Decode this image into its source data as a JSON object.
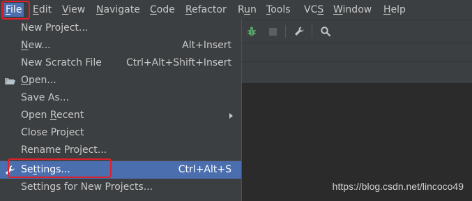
{
  "menubar": {
    "items": [
      "File",
      "Edit",
      "View",
      "Navigate",
      "Code",
      "Refactor",
      "Run",
      "Tools",
      "VCS",
      "Window",
      "Help"
    ],
    "mnemonics": [
      "F",
      "E",
      "V",
      "N",
      "C",
      "R",
      "u",
      "T",
      "S",
      "W",
      "H"
    ],
    "active": "File"
  },
  "toolbar": {
    "icons": [
      "debug-bug-icon",
      "stop-icon",
      "wrench-icon",
      "search-icon"
    ]
  },
  "file_menu": {
    "items": [
      {
        "label": "New Project...",
        "shortcut": ""
      },
      {
        "label": "New...",
        "shortcut": "Alt+Insert"
      },
      {
        "label": "New Scratch File",
        "shortcut": "Ctrl+Alt+Shift+Insert"
      },
      {
        "label": "Open...",
        "shortcut": "",
        "icon": "folder-icon"
      },
      {
        "label": "Save As...",
        "shortcut": ""
      },
      {
        "label": "Open Recent",
        "shortcut": "",
        "submenu": true
      },
      {
        "label": "Close Project",
        "shortcut": ""
      },
      {
        "label": "Rename Project...",
        "shortcut": ""
      },
      {
        "label": "Settings...",
        "shortcut": "Ctrl+Alt+S",
        "icon": "wrench-icon",
        "selected": true
      },
      {
        "label": "Settings for New Projects...",
        "shortcut": ""
      }
    ]
  },
  "watermark": "https://blog.csdn.net/lincoco49",
  "colors": {
    "accent": "#4b6eaf",
    "highlight_box": "#e0202a",
    "menu_bg": "#3c3f41",
    "editor_bg": "#2b2b2b"
  }
}
